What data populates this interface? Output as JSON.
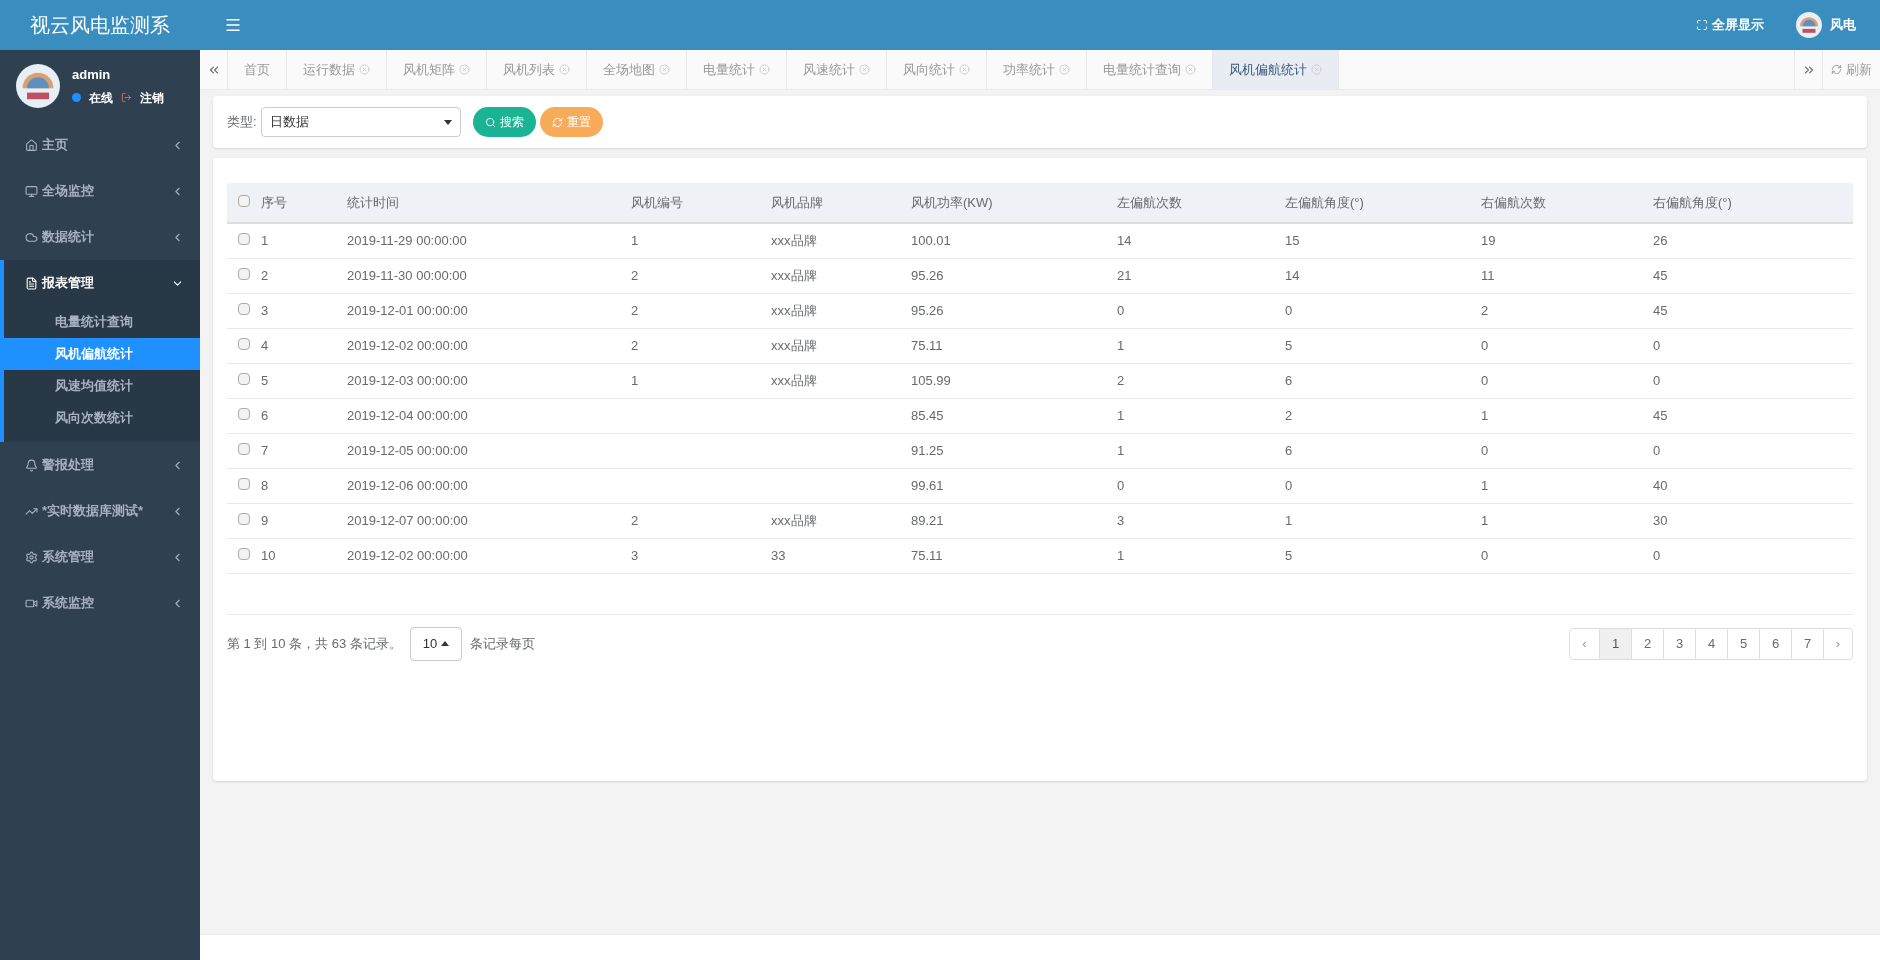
{
  "app_title": "视云风电监测系",
  "header": {
    "fullscreen": "全屏显示",
    "user": "风电"
  },
  "profile": {
    "name": "admin",
    "status": "在线",
    "logout": "注销"
  },
  "sidebar": {
    "items": [
      {
        "label": "主页",
        "expanded": false
      },
      {
        "label": "全场监控",
        "expanded": false
      },
      {
        "label": "数据统计",
        "expanded": false
      },
      {
        "label": "报表管理",
        "expanded": true,
        "children": [
          {
            "label": "电量统计查询",
            "selected": false
          },
          {
            "label": "风机偏航统计",
            "selected": true
          },
          {
            "label": "风速均值统计",
            "selected": false
          },
          {
            "label": "风向次数统计",
            "selected": false
          }
        ]
      },
      {
        "label": "警报处理",
        "expanded": false
      },
      {
        "label": "*实时数据库测试*",
        "expanded": false
      },
      {
        "label": "系统管理",
        "expanded": false
      },
      {
        "label": "系统监控",
        "expanded": false
      }
    ]
  },
  "tabs": [
    {
      "label": "首页",
      "closable": false,
      "selected": false
    },
    {
      "label": "运行数据",
      "closable": true,
      "selected": false
    },
    {
      "label": "风机矩阵",
      "closable": true,
      "selected": false
    },
    {
      "label": "风机列表",
      "closable": true,
      "selected": false
    },
    {
      "label": "全场地图",
      "closable": true,
      "selected": false
    },
    {
      "label": "电量统计",
      "closable": true,
      "selected": false
    },
    {
      "label": "风速统计",
      "closable": true,
      "selected": false
    },
    {
      "label": "风向统计",
      "closable": true,
      "selected": false
    },
    {
      "label": "功率统计",
      "closable": true,
      "selected": false
    },
    {
      "label": "电量统计查询",
      "closable": true,
      "selected": false
    },
    {
      "label": "风机偏航统计",
      "closable": true,
      "selected": true
    }
  ],
  "refresh": "刷新",
  "filter": {
    "label": "类型:",
    "value": "日数据",
    "search": "搜索",
    "reset": "重置"
  },
  "table": {
    "all_checked": false,
    "columns": [
      "序号",
      "统计时间",
      "风机编号",
      "风机品牌",
      "风机功率(KW)",
      "左偏航次数",
      "左偏航角度(°)",
      "右偏航次数",
      "右偏航角度(°)"
    ],
    "rows": [
      {
        "checked": false,
        "cells": [
          "1",
          "2019-11-29 00:00:00",
          "1",
          "xxx品牌",
          "100.01",
          "14",
          "15",
          "19",
          "26"
        ]
      },
      {
        "checked": false,
        "cells": [
          "2",
          "2019-11-30 00:00:00",
          "2",
          "xxx品牌",
          "95.26",
          "21",
          "14",
          "11",
          "45"
        ]
      },
      {
        "checked": false,
        "cells": [
          "3",
          "2019-12-01 00:00:00",
          "2",
          "xxx品牌",
          "95.26",
          "0",
          "0",
          "2",
          "45"
        ]
      },
      {
        "checked": false,
        "cells": [
          "4",
          "2019-12-02 00:00:00",
          "2",
          "xxx品牌",
          "75.11",
          "1",
          "5",
          "0",
          "0"
        ]
      },
      {
        "checked": false,
        "cells": [
          "5",
          "2019-12-03 00:00:00",
          "1",
          "xxx品牌",
          "105.99",
          "2",
          "6",
          "0",
          "0"
        ]
      },
      {
        "checked": false,
        "cells": [
          "6",
          "2019-12-04 00:00:00",
          null,
          null,
          "85.45",
          "1",
          "2",
          "1",
          "45"
        ]
      },
      {
        "checked": false,
        "cells": [
          "7",
          "2019-12-05 00:00:00",
          null,
          null,
          "91.25",
          "1",
          "6",
          "0",
          "0"
        ]
      },
      {
        "checked": false,
        "cells": [
          "8",
          "2019-12-06 00:00:00",
          null,
          null,
          "99.61",
          "0",
          "0",
          "1",
          "40"
        ]
      },
      {
        "checked": false,
        "cells": [
          "9",
          "2019-12-07 00:00:00",
          "2",
          "xxx品牌",
          "89.21",
          "3",
          "1",
          "1",
          "30"
        ]
      },
      {
        "checked": false,
        "cells": [
          "10",
          "2019-12-02 00:00:00",
          "3",
          "33",
          "75.11",
          "1",
          "5",
          "0",
          "0"
        ]
      }
    ]
  },
  "pagination": {
    "summary": "第 1 到 10 条，共 63 条记录。",
    "page_size": "10",
    "page_size_suffix": "条记录每页",
    "prev": "‹",
    "next": "›",
    "pages": [
      {
        "label": "1",
        "selected": true
      },
      {
        "label": "2",
        "selected": false
      },
      {
        "label": "3",
        "selected": false
      },
      {
        "label": "4",
        "selected": false
      },
      {
        "label": "5",
        "selected": false
      },
      {
        "label": "6",
        "selected": false
      },
      {
        "label": "7",
        "selected": false
      }
    ]
  }
}
